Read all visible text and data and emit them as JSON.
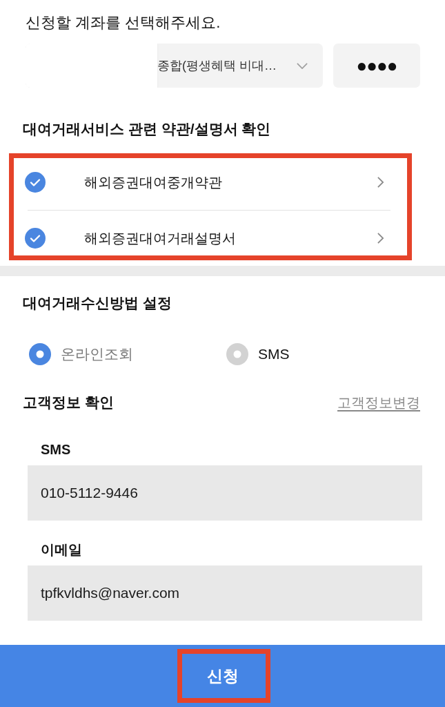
{
  "account_section": {
    "title": "신청할 계좌를 선택해주세요.",
    "account_select": {
      "value": "종합(평생혜택 비대…",
      "redacted": true
    },
    "password_field": {
      "value": "●●●●"
    }
  },
  "terms_section": {
    "title": "대여거래서비스 관련 약관/설명서 확인",
    "highlighted": true,
    "items": [
      {
        "label": "해외증권대여중개약관",
        "checked": true
      },
      {
        "label": "해외증권대여거래설명서",
        "checked": true
      }
    ]
  },
  "receive_method": {
    "title": "대여거래수신방법 설정",
    "options": [
      {
        "label": "온라인조회",
        "selected": true
      },
      {
        "label": "SMS",
        "selected": false
      }
    ]
  },
  "customer_info": {
    "title": "고객정보 확인",
    "change_link": "고객정보변경",
    "fields": [
      {
        "label": "SMS",
        "value": "010-5112-9446"
      },
      {
        "label": "이메일",
        "value": "tpfkvldhs@naver.com"
      }
    ]
  },
  "submit": {
    "label": "신청",
    "highlighted": true
  }
}
